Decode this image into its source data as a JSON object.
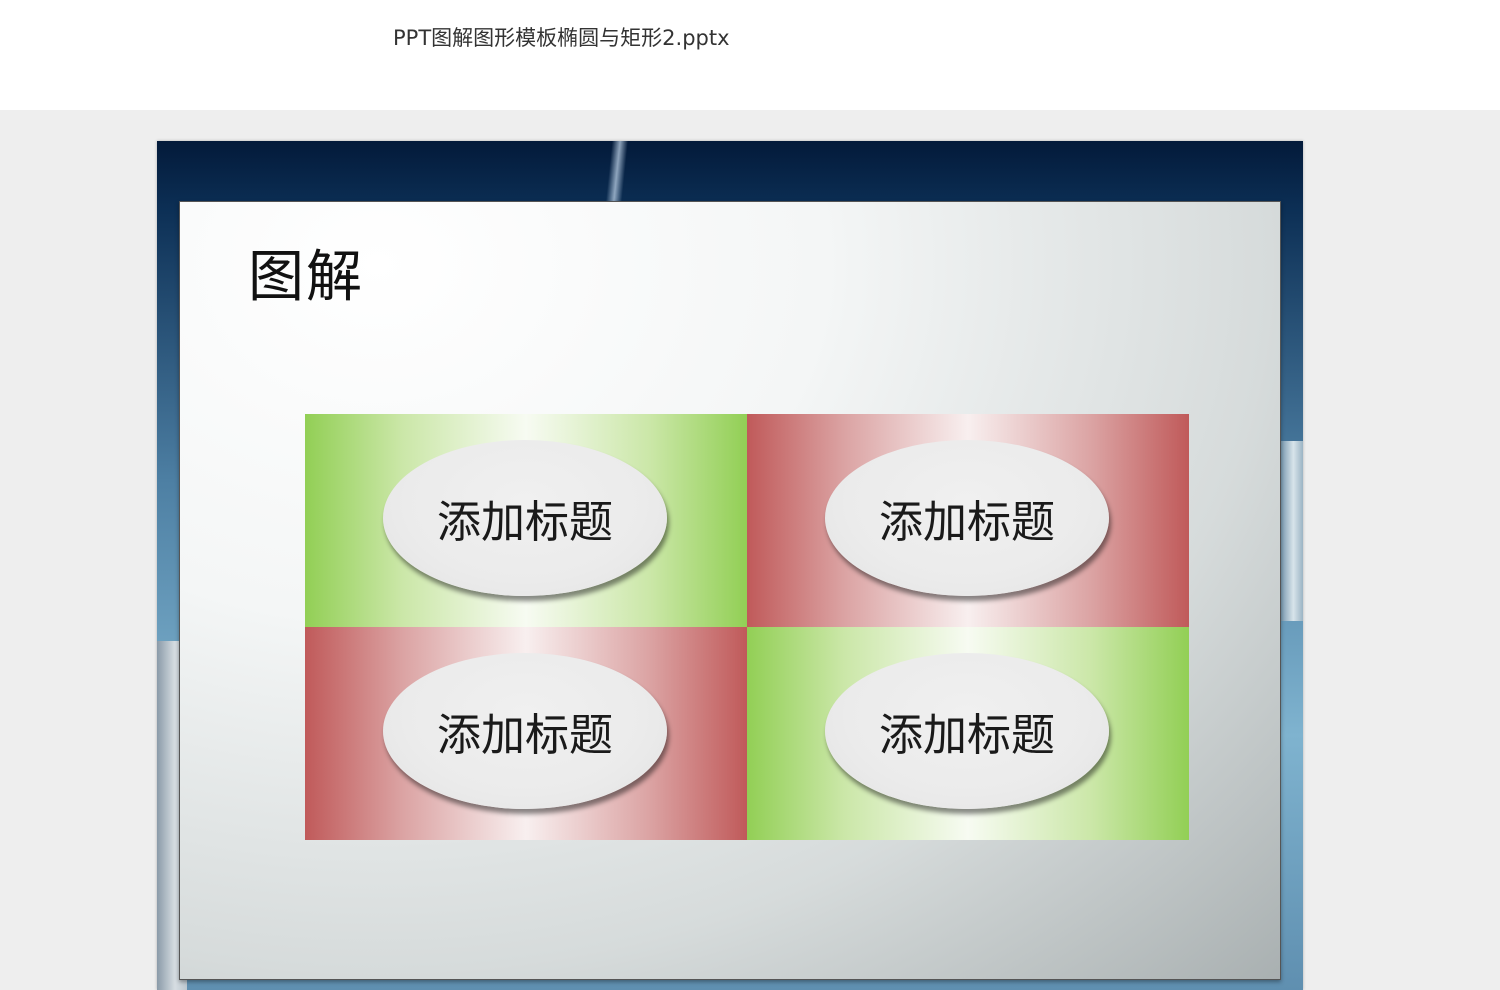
{
  "header": {
    "file_name": "PPT图解图形模板椭圆与矩形2.pptx"
  },
  "slide": {
    "heading": "图解",
    "cells": [
      {
        "label": "添加标题",
        "color": "green"
      },
      {
        "label": "添加标题",
        "color": "red"
      },
      {
        "label": "添加标题",
        "color": "red"
      },
      {
        "label": "添加标题",
        "color": "green"
      }
    ]
  },
  "colors": {
    "green": "#92cf55",
    "red": "#c05a5a",
    "viewer_background": "#eeeeee"
  }
}
